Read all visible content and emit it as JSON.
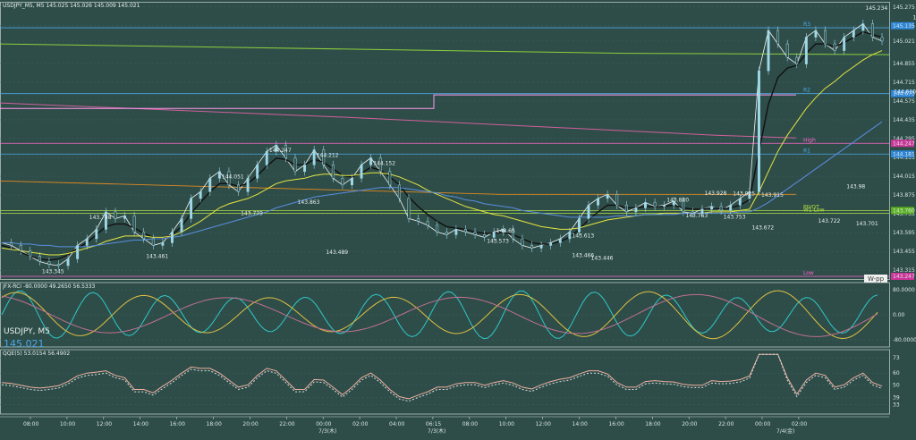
{
  "chart_data": {
    "type": "line",
    "title": "USDJPY_M5, M5  145.025 145.026 145.009 145.021",
    "symbol_label": "USDJPY, M5",
    "last_price": "145.021",
    "price_axis": [
      "145.275",
      "145.135",
      "145.021",
      "144.855",
      "144.715",
      "144.575",
      "144.435",
      "144.295",
      "144.155",
      "144.015",
      "143.875",
      "143.735",
      "143.595",
      "143.455",
      "143.315"
    ],
    "ylim": [
      143.25,
      145.3
    ],
    "time_axis": [
      "08:00",
      "10:00",
      "12:00",
      "14:00",
      "16:00",
      "18:00",
      "20:00",
      "22:00",
      "00:00",
      "02:00",
      "04:00",
      "06:15",
      "08:00",
      "10:00",
      "12:00",
      "14:00",
      "16:00",
      "18:00",
      "20:00",
      "22:00",
      "00:00",
      "02:00"
    ],
    "date_labels": [
      "7/3(木)",
      "7/3(木)",
      "7/4(金)"
    ],
    "series": [
      {
        "values": [
          143.52,
          143.5,
          143.46,
          143.42,
          143.38,
          143.36,
          143.35,
          143.4,
          143.5,
          143.55,
          143.62,
          143.75,
          143.7,
          143.72,
          143.6,
          143.55,
          143.5,
          143.52,
          143.6,
          143.7,
          143.85,
          143.9,
          144.0,
          144.05,
          143.95,
          143.9,
          144.0,
          144.1,
          144.2,
          144.247,
          144.15,
          144.05,
          144.1,
          144.212,
          144.1,
          144.0,
          143.95,
          144.0,
          144.1,
          144.152,
          144.05,
          143.95,
          143.85,
          143.7,
          143.68,
          143.65,
          143.6,
          143.58,
          143.62,
          143.6,
          143.58,
          143.56,
          143.6,
          143.62,
          143.55,
          143.5,
          143.48,
          143.5,
          143.52,
          143.55,
          143.6,
          143.7,
          143.8,
          143.85,
          143.88,
          143.8,
          143.75,
          143.78,
          143.82,
          143.79,
          143.8,
          143.83,
          143.75,
          143.74,
          143.77,
          143.79,
          143.76,
          143.8,
          143.85,
          143.9,
          144.8,
          145.1,
          145.0,
          144.9,
          144.85,
          145.05,
          145.1,
          145.0,
          144.95,
          145.05,
          145.1,
          145.15,
          145.05,
          145.021
        ]
      },
      {
        "values": [
          143.5,
          143.48,
          143.45,
          143.42,
          143.4,
          143.39,
          143.4,
          143.43,
          143.48,
          143.52,
          143.58,
          143.64,
          143.66,
          143.66,
          143.63,
          143.59,
          143.56,
          143.55,
          143.58,
          143.64,
          143.74,
          143.82,
          143.9,
          143.96,
          143.96,
          143.94,
          143.96,
          144.02,
          144.09,
          144.15,
          144.14,
          144.1,
          144.1,
          144.14,
          144.12,
          144.07,
          144.02,
          144.01,
          144.04,
          144.08,
          144.06,
          144.01,
          143.95,
          143.86,
          143.79,
          143.73,
          143.68,
          143.64,
          143.63,
          143.62,
          143.6,
          143.59,
          143.59,
          143.6,
          143.58,
          143.55,
          143.52,
          143.51,
          143.51,
          143.53,
          143.56,
          143.62,
          143.69,
          143.75,
          143.8,
          143.8,
          143.78,
          143.78,
          143.79,
          143.79,
          143.79,
          143.8,
          143.78,
          143.77,
          143.77,
          143.78,
          143.77,
          143.78,
          143.8,
          143.84,
          144.2,
          144.55,
          144.75,
          144.82,
          144.84,
          144.93,
          145.0,
          145.0,
          144.98,
          145.01,
          145.05,
          145.09,
          145.07,
          145.05
        ]
      },
      {
        "values": [
          143.48,
          143.47,
          143.46,
          143.45,
          143.44,
          143.43,
          143.43,
          143.44,
          143.46,
          143.48,
          143.5,
          143.53,
          143.55,
          143.57,
          143.57,
          143.57,
          143.56,
          143.56,
          143.57,
          143.6,
          143.64,
          143.68,
          143.73,
          143.78,
          143.81,
          143.83,
          143.85,
          143.88,
          143.92,
          143.96,
          143.98,
          143.99,
          144.0,
          144.02,
          144.03,
          144.03,
          144.02,
          144.02,
          144.03,
          144.04,
          144.04,
          144.03,
          144.01,
          143.98,
          143.95,
          143.91,
          143.88,
          143.85,
          143.82,
          143.79,
          143.77,
          143.75,
          143.73,
          143.72,
          143.7,
          143.68,
          143.66,
          143.64,
          143.63,
          143.62,
          143.62,
          143.63,
          143.65,
          143.67,
          143.69,
          143.7,
          143.71,
          143.72,
          143.73,
          143.73,
          143.74,
          143.74,
          143.74,
          143.74,
          143.74,
          143.75,
          143.75,
          143.75,
          143.76,
          143.77,
          143.9,
          144.05,
          144.2,
          144.32,
          144.42,
          144.52,
          144.6,
          144.67,
          144.72,
          144.78,
          144.83,
          144.88,
          144.92,
          144.95
        ]
      },
      {
        "values": [
          143.52,
          143.52,
          143.51,
          143.51,
          143.5,
          143.5,
          143.49,
          143.49,
          143.49,
          143.49,
          143.5,
          143.51,
          143.52,
          143.53,
          143.54,
          143.54,
          143.55,
          143.55,
          143.56,
          143.57,
          143.59,
          143.61,
          143.63,
          143.65,
          143.67,
          143.69,
          143.71,
          143.73,
          143.75,
          143.78,
          143.8,
          143.82,
          143.84,
          143.86,
          143.87,
          143.88,
          143.89,
          143.9,
          143.91,
          143.92,
          143.93,
          143.93,
          143.93,
          143.92,
          143.91,
          143.9,
          143.89,
          143.87,
          143.86,
          143.84,
          143.83,
          143.81,
          143.8,
          143.79,
          143.78,
          143.76,
          143.75,
          143.74,
          143.73,
          143.72,
          143.71,
          143.71,
          143.71,
          143.71,
          143.71,
          143.72,
          143.72,
          143.72,
          143.73,
          143.73,
          143.73,
          143.73,
          143.74,
          143.74,
          143.74,
          143.74,
          143.74,
          143.74,
          143.75,
          143.75,
          143.78,
          143.82,
          143.87,
          143.92,
          143.97,
          144.02,
          144.07,
          144.12,
          144.17,
          144.22,
          144.27,
          144.32,
          144.37,
          144.42
        ]
      }
    ],
    "price_labels": [
      {
        "t": 10,
        "p": 143.748,
        "text": "143.748"
      },
      {
        "t": 5,
        "p": 143.345,
        "text": "143.345"
      },
      {
        "t": 16,
        "p": 143.461,
        "text": "143.461"
      },
      {
        "t": 24,
        "p": 144.051,
        "text": "144.051"
      },
      {
        "t": 26,
        "p": 143.779,
        "text": "143.779"
      },
      {
        "t": 29,
        "p": 144.247,
        "text": "144.247"
      },
      {
        "t": 32,
        "p": 143.863,
        "text": "143.863"
      },
      {
        "t": 34,
        "p": 144.212,
        "text": "144.212"
      },
      {
        "t": 35,
        "p": 143.489,
        "text": "143.489"
      },
      {
        "t": 40,
        "p": 144.152,
        "text": "144.152"
      },
      {
        "t": 53,
        "p": 143.65,
        "text": "143.65"
      },
      {
        "t": 52,
        "p": 143.573,
        "text": "143.573"
      },
      {
        "t": 61,
        "p": 143.613,
        "text": "143.613"
      },
      {
        "t": 61,
        "p": 143.466,
        "text": "143.466"
      },
      {
        "t": 63,
        "p": 143.446,
        "text": "143.446"
      },
      {
        "t": 71,
        "p": 143.88,
        "text": "143.880"
      },
      {
        "t": 73,
        "p": 143.763,
        "text": "143.763"
      },
      {
        "t": 75,
        "p": 143.928,
        "text": "143.928"
      },
      {
        "t": 77,
        "p": 143.753,
        "text": "143.753"
      },
      {
        "t": 78,
        "p": 143.925,
        "text": "143.925"
      },
      {
        "t": 80,
        "p": 143.672,
        "text": "143.672"
      },
      {
        "t": 81,
        "p": 143.915,
        "text": "143.915"
      },
      {
        "t": 87,
        "p": 143.722,
        "text": "143.722"
      },
      {
        "t": 90,
        "p": 143.98,
        "text": "143.98"
      },
      {
        "t": 91,
        "p": 143.701,
        "text": "143.701"
      },
      {
        "t": 92,
        "p": 145.234,
        "text": "145.234"
      },
      {
        "t": 95,
        "p": 144.61,
        "text": "144.610"
      },
      {
        "t": 97,
        "p": 145.164,
        "text": "145.164"
      },
      {
        "t": 98,
        "p": 144.818,
        "text": "144.818"
      },
      {
        "t": 100,
        "p": 145.214,
        "text": "145.214"
      },
      {
        "t": 101,
        "p": 144.996,
        "text": "144.996"
      }
    ],
    "levels": [
      {
        "name": "R3",
        "value": 145.12,
        "color": "#4aa8e8"
      },
      {
        "name": "R2",
        "value": 144.63,
        "color": "#4aa8e8"
      },
      {
        "name": "High",
        "value": 144.26,
        "color": "#ff66cc"
      },
      {
        "name": "R1",
        "value": 144.18,
        "color": "#4aa8e8"
      },
      {
        "name": "PIVOT",
        "value": 143.76,
        "color": "#b0e040"
      },
      {
        "name": "W1 Low",
        "value": 143.74,
        "color": "#b0e040"
      },
      {
        "name": "Low",
        "value": 143.27,
        "color": "#ff66cc"
      }
    ],
    "level_tags": [
      {
        "text": "145.135",
        "value": 145.135,
        "color": "#2e86d8"
      },
      {
        "text": "144.673",
        "value": 144.63,
        "color": "#2e86d8"
      },
      {
        "text": "144.247",
        "value": 144.26,
        "color": "#cc3399"
      },
      {
        "text": "144.181",
        "value": 144.18,
        "color": "#2e86d8"
      },
      {
        "text": "143.760",
        "value": 143.76,
        "color": "#5ab020"
      },
      {
        "text": "143.247",
        "value": 143.27,
        "color": "#cc3399"
      }
    ],
    "wpp_label": "W-pp",
    "indicator1": {
      "title": "JFX-RCI -80.0000 49.2650 56.5333",
      "axis": [
        "80.0000",
        "0.00",
        "-80.0000"
      ]
    },
    "indicator2": {
      "title": "QQE(5) 53.0154 56.4902",
      "axis": [
        "73",
        "60",
        "50",
        "39",
        "33"
      ]
    }
  }
}
